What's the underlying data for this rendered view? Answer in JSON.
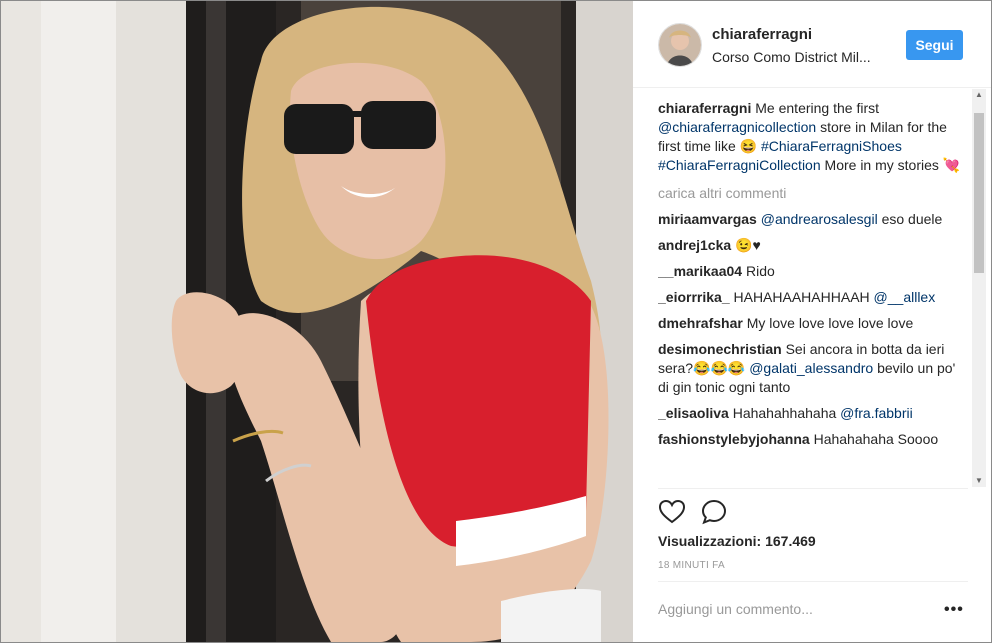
{
  "post": {
    "username": "chiaraferragni",
    "location": "Corso Como District Mil...",
    "follow_label": "Segui",
    "caption": {
      "user": "chiaraferragni",
      "text1": "Me entering the first",
      "mention": "@chiaraferragnicollection",
      "text2": "store in Milan for the first time like 😆",
      "hashtag1": "#ChiaraFerragniShoes",
      "hashtag2": "#ChiaraFerragniCollection",
      "text3": "More in my stories 💘"
    },
    "load_more": "carica altri commenti",
    "comments": [
      {
        "user": "miriaamvargas",
        "mention": "@andrearosalesgil",
        "text": " eso duele"
      },
      {
        "user": "andrej1cka",
        "text": " 😉♥"
      },
      {
        "user": "__marikaa04",
        "text": " Rido"
      },
      {
        "user": "_eiorrrika_",
        "text": " HAHAHAAHAHHAAH ",
        "mention2": "@__alllex"
      },
      {
        "user": "dmehrafshar",
        "text": " My love love love love love"
      },
      {
        "user": "desimonechristian",
        "text": " Sei ancora in botta da ieri sera?😂😂😂 ",
        "mention2": "@galati_alessandro",
        "text2": " bevilo un po' di gin tonic ogni tanto"
      },
      {
        "user": "_elisaoliva",
        "text": " Hahahahhahaha ",
        "mention2": "@fra.fabbrii"
      },
      {
        "user": "fashionstylebyjohanna",
        "text": " Hahahahaha Soooo"
      }
    ],
    "views_label": "Visualizzazioni: 167.469",
    "time_ago": "18 MINUTI FA",
    "add_comment_placeholder": "Aggiungi un commento...",
    "more_options": "•••"
  },
  "colors": {
    "follow_button": "#3897f0",
    "link": "#003569",
    "muted": "#999999"
  }
}
